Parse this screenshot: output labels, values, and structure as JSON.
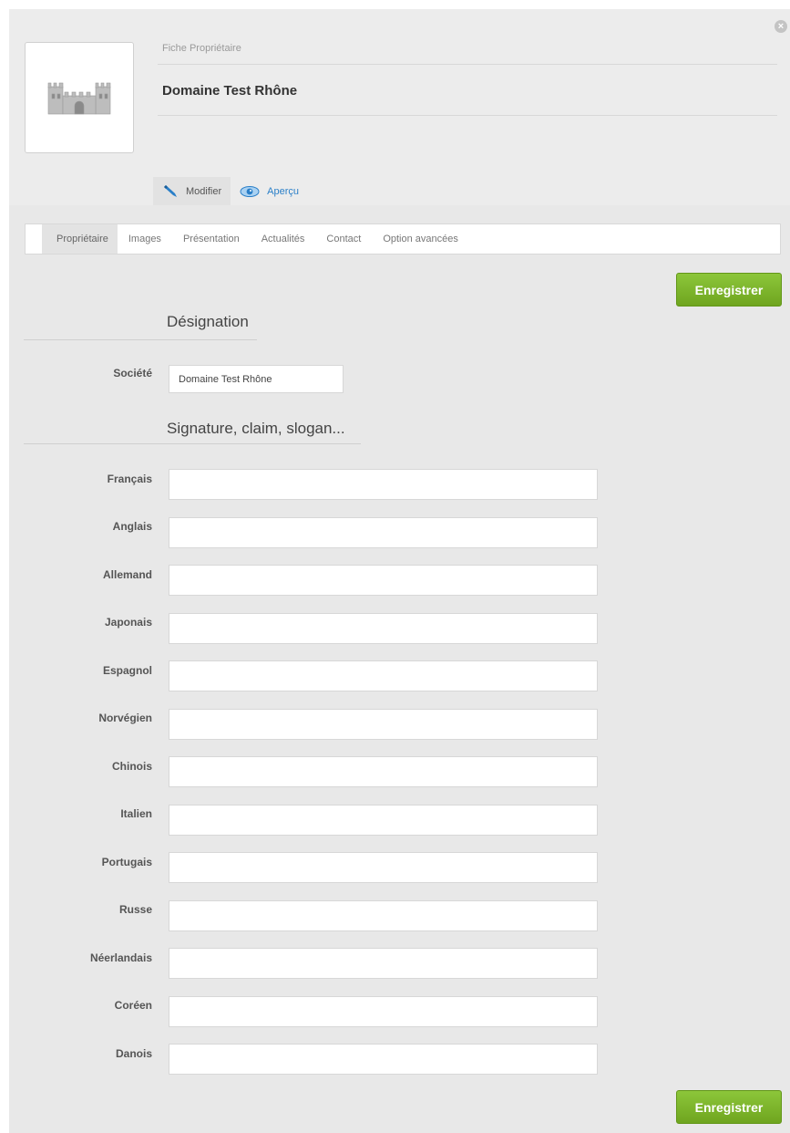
{
  "header": {
    "breadcrumb": "Fiche Propriétaire",
    "title": "Domaine Test Rhône",
    "close_label": "×",
    "logo_icon": "castle-icon"
  },
  "mode_tabs": [
    {
      "label": "Modifier",
      "icon": "pencil-icon"
    },
    {
      "label": "Aperçu",
      "icon": "eye-icon"
    }
  ],
  "nav": [
    {
      "label": "Propriétaire"
    },
    {
      "label": "Images"
    },
    {
      "label": "Présentation"
    },
    {
      "label": "Actualités"
    },
    {
      "label": "Contact"
    },
    {
      "label": "Option avancées"
    }
  ],
  "actions": {
    "save_label": "Enregistrer"
  },
  "designation": {
    "title": "Désignation",
    "company_label": "Société",
    "company_value": "Domaine Test Rhône"
  },
  "signature": {
    "title": "Signature, claim, slogan...",
    "languages": [
      {
        "label": "Français",
        "value": ""
      },
      {
        "label": "Anglais",
        "value": ""
      },
      {
        "label": "Allemand",
        "value": ""
      },
      {
        "label": "Japonais",
        "value": ""
      },
      {
        "label": "Espagnol",
        "value": ""
      },
      {
        "label": "Norvégien",
        "value": ""
      },
      {
        "label": "Chinois",
        "value": ""
      },
      {
        "label": "Italien",
        "value": ""
      },
      {
        "label": "Portugais",
        "value": ""
      },
      {
        "label": "Russe",
        "value": ""
      },
      {
        "label": "Néerlandais",
        "value": ""
      },
      {
        "label": "Coréen",
        "value": ""
      },
      {
        "label": "Danois",
        "value": ""
      }
    ]
  },
  "colors": {
    "accent_green": "#7ab52b",
    "link_blue": "#2a7fc8"
  }
}
